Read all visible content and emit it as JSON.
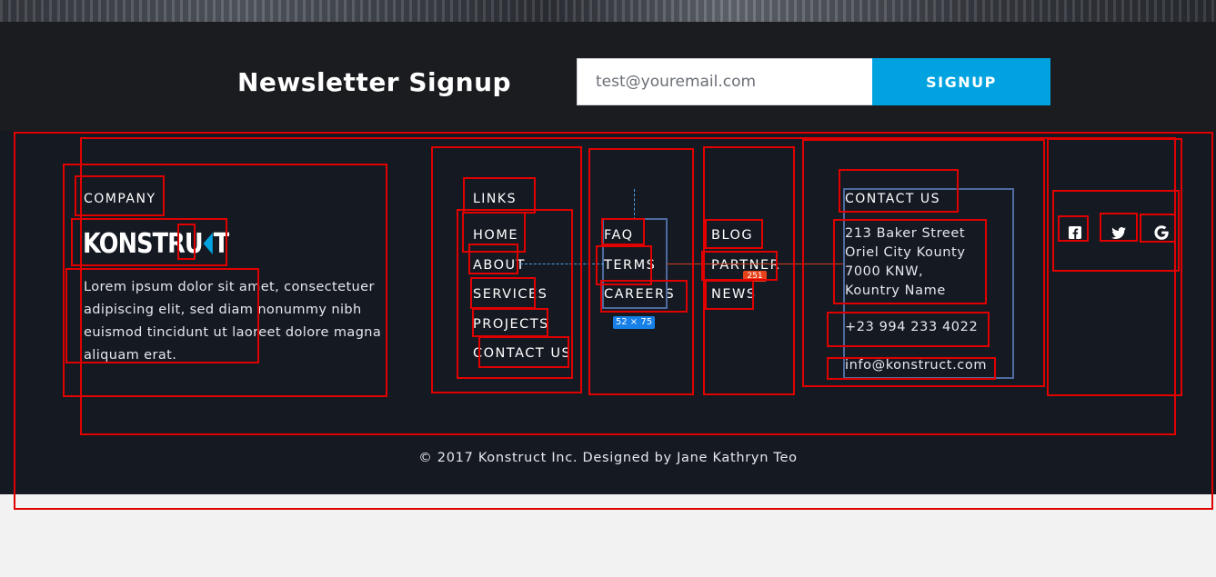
{
  "newsletter": {
    "title": "Newsletter Signup",
    "email_placeholder": "test@youremail.com",
    "signup_label": "SIGNUP"
  },
  "company": {
    "title": "COMPANY",
    "logo_text_left": "KONSTRU",
    "logo_text_right": "T",
    "description": "Lorem ipsum dolor sit amet, consectetuer adipiscing elit, sed diam nonummy nibh euismod tincidunt ut laoreet dolore magna aliquam erat."
  },
  "links": {
    "title": "LINKS",
    "main": [
      "HOME",
      "ABOUT",
      "SERVICES",
      "PROJECTS",
      "CONTACT US"
    ],
    "secondary": [
      "FAQ",
      "TERMS",
      "CAREERS"
    ],
    "tertiary": [
      "BLOG",
      "PARTNER",
      "NEWS"
    ]
  },
  "contact": {
    "title": "CONTACT US",
    "address": [
      "213 Baker Street",
      "Oriel City Kounty",
      "7000 KNW,",
      "Kountry Name"
    ],
    "phone": "+23 994 233 4022",
    "email": "info@konstruct.com"
  },
  "social": [
    "facebook-icon",
    "twitter-icon",
    "google-icon"
  ],
  "copyright": "© 2017 Konstruct Inc. Designed by Jane Kathryn Teo",
  "inspector": {
    "size_badge": "52 × 75",
    "distance_badge": "251"
  },
  "colors": {
    "accent": "#00a3e0",
    "footer_bg": "#151922",
    "newsletter_bg": "#1b1c20",
    "overlay_red": "#e00000"
  }
}
